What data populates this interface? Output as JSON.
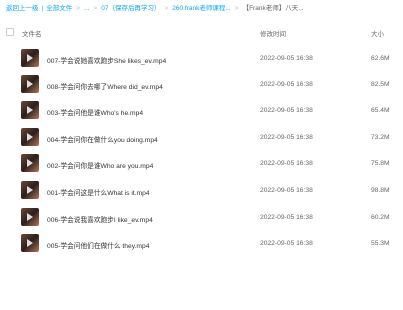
{
  "breadcrumb": {
    "back": "返回上一级",
    "items": [
      "全部文件",
      "...",
      "07（保存后再学习）",
      "260.frank老师课程...",
      "【Frank老师】八天..."
    ]
  },
  "header": {
    "name": "文件名",
    "modified": "修改时间",
    "size": "大小"
  },
  "files": [
    {
      "name": "007-学会说她喜欢跑步She likes_ev.mp4",
      "modified": "2022-09-05 16:38",
      "size": "62.6M"
    },
    {
      "name": "008-学会问你去哪了Where did_ev.mp4",
      "modified": "2022-09-05 16:38",
      "size": "82.5M"
    },
    {
      "name": "003-学会问他是谁Who's he.mp4",
      "modified": "2022-09-05 16:38",
      "size": "65.4M"
    },
    {
      "name": "004-学会问你在做什么you doing.mp4",
      "modified": "2022-09-05 16:38",
      "size": "73.2M"
    },
    {
      "name": "002-学会问你是谁Who are you.mp4",
      "modified": "2022-09-05 16:38",
      "size": "75.8M"
    },
    {
      "name": "001-学会问这是什么What is it.mp4",
      "modified": "2022-09-05 16:38",
      "size": "98.8M"
    },
    {
      "name": "006-学会说我喜欢跑步I like_ev.mp4",
      "modified": "2022-09-05 16:38",
      "size": "60.2M"
    },
    {
      "name": "005-学会问他们在做什么 they.mp4",
      "modified": "2022-09-05 16:38",
      "size": "55.3M"
    }
  ]
}
